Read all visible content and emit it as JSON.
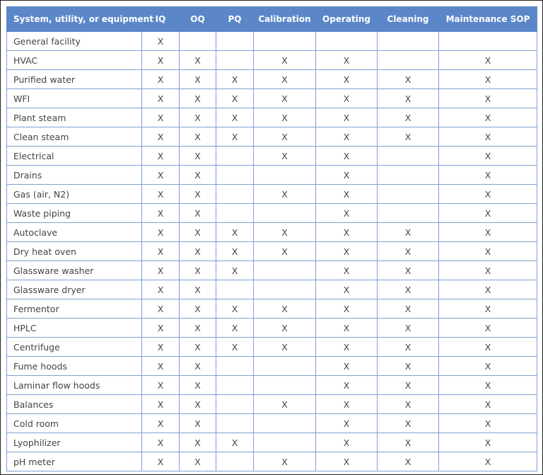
{
  "table": {
    "columns": [
      "System, utility, or equipment",
      "IQ",
      "OQ",
      "PQ",
      "Calibration",
      "Operating",
      "Cleaning",
      "Maintenance SOP"
    ],
    "rows": [
      [
        "General facility",
        "X",
        "",
        "",
        "",
        "",
        "",
        ""
      ],
      [
        "HVAC",
        "X",
        "X",
        "",
        "X",
        "X",
        "",
        "X"
      ],
      [
        "Purified water",
        "X",
        "X",
        "X",
        "X",
        "X",
        "X",
        "X"
      ],
      [
        "WFI",
        "X",
        "X",
        "X",
        "X",
        "X",
        "X",
        "X"
      ],
      [
        "Plant steam",
        "X",
        "X",
        "X",
        "X",
        "X",
        "X",
        "X"
      ],
      [
        "Clean steam",
        "X",
        "X",
        "X",
        "X",
        "X",
        "X",
        "X"
      ],
      [
        "Electrical",
        "X",
        "X",
        "",
        "X",
        "X",
        "",
        "X"
      ],
      [
        "Drains",
        "X",
        "X",
        "",
        "",
        "X",
        "",
        "X"
      ],
      [
        "Gas (air, N2)",
        "X",
        "X",
        "",
        "X",
        "X",
        "",
        "X"
      ],
      [
        "Waste piping",
        "X",
        "X",
        "",
        "",
        "X",
        "",
        "X"
      ],
      [
        "Autoclave",
        "X",
        "X",
        "X",
        "X",
        "X",
        "X",
        "X"
      ],
      [
        "Dry heat oven",
        "X",
        "X",
        "X",
        "X",
        "X",
        "X",
        "X"
      ],
      [
        "Glassware washer",
        "X",
        "X",
        "X",
        "",
        "X",
        "X",
        "X"
      ],
      [
        "Glassware dryer",
        "X",
        "X",
        "",
        "",
        "X",
        "X",
        "X"
      ],
      [
        "Fermentor",
        "X",
        "X",
        "X",
        "X",
        "X",
        "X",
        "X"
      ],
      [
        "HPLC",
        "X",
        "X",
        "X",
        "X",
        "X",
        "X",
        "X"
      ],
      [
        "Centrifuge",
        "X",
        "X",
        "X",
        "X",
        "X",
        "X",
        "X"
      ],
      [
        "Fume hoods",
        "X",
        "X",
        "",
        "",
        "X",
        "X",
        "X"
      ],
      [
        "Laminar flow hoods",
        "X",
        "X",
        "",
        "",
        "X",
        "X",
        "X"
      ],
      [
        "Balances",
        "X",
        "X",
        "",
        "X",
        "X",
        "X",
        "X"
      ],
      [
        "Cold room",
        "X",
        "X",
        "",
        "",
        "X",
        "X",
        "X"
      ],
      [
        "Lyophilizer",
        "X",
        "X",
        "X",
        "",
        "X",
        "X",
        "X"
      ],
      [
        "pH meter",
        "X",
        "X",
        "",
        "X",
        "X",
        "X",
        "X"
      ]
    ]
  },
  "colors": {
    "header_bg": "#5b87c8",
    "border": "#7fa1d2",
    "text": "#444444"
  }
}
